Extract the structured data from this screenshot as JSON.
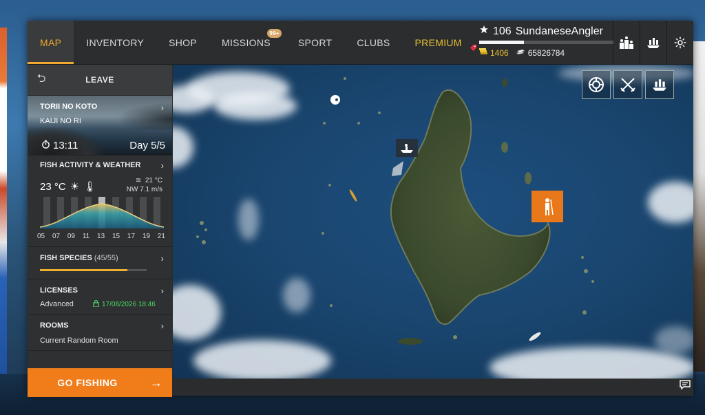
{
  "nav": {
    "tabs": [
      {
        "label": "MAP",
        "active": true
      },
      {
        "label": "INVENTORY"
      },
      {
        "label": "SHOP"
      },
      {
        "label": "MISSIONS",
        "badge": "99+"
      },
      {
        "label": "SPORT"
      },
      {
        "label": "CLUBS"
      },
      {
        "label": "PREMIUM"
      }
    ]
  },
  "player": {
    "level": "106",
    "name": "SundaneseAngler",
    "gold": "1406",
    "silver": "65826784",
    "xp_fraction": 0.33
  },
  "top_icons": [
    "leaderboard-icon",
    "ship-icon",
    "settings-icon"
  ],
  "side": {
    "leave_label": "LEAVE",
    "location": {
      "name": "TORII NO KOTO",
      "sub": "KAIJI NO RI",
      "time": "13:11",
      "day": "Day 5/5"
    },
    "weather": {
      "title": "FISH ACTIVITY & WEATHER",
      "air_temp": "23 °C",
      "water_temp": "21 °C",
      "wind": "NW 7.1 m/s",
      "hours": [
        "05",
        "07",
        "09",
        "11",
        "13",
        "15",
        "17",
        "19",
        "21"
      ],
      "current_hour_index": 4
    },
    "species": {
      "title": "FISH SPECIES",
      "count": "(45/55)",
      "fraction": 0.818
    },
    "licenses": {
      "title": "LICENSES",
      "type": "Advanced",
      "expires": "17/08/2026 18:46"
    },
    "rooms": {
      "title": "ROOMS",
      "value": "Current Random Room"
    },
    "go_label": "GO FISHING"
  },
  "map_tools": [
    "lifebuoy-icon",
    "crossed-swords-icon",
    "ship-icon"
  ],
  "colors": {
    "accent": "#f0a830",
    "go": "#f07d1a",
    "premium": "#e8c030",
    "license": "#4cd964"
  }
}
